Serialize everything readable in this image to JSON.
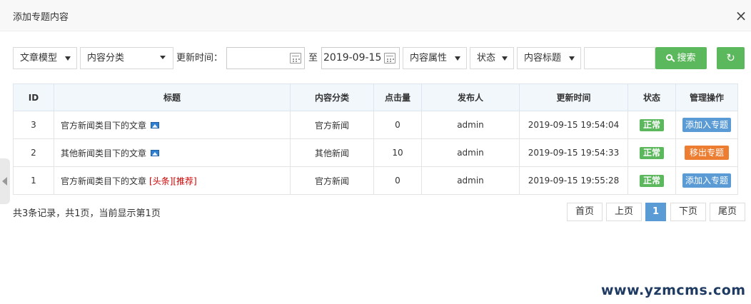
{
  "dialog": {
    "title": "添加专题内容",
    "close_symbol": "×"
  },
  "filters": {
    "model": "文章模型",
    "category": "内容分类",
    "update_time_label": "更新时间：",
    "date_start": "",
    "to_label": "至",
    "date_end": "2019-09-15",
    "attribute": "内容属性",
    "status": "状态",
    "field": "内容标题",
    "keyword": "",
    "search_label": "搜索",
    "refresh_symbol": "↻"
  },
  "table": {
    "headers": [
      "ID",
      "标题",
      "内容分类",
      "点击量",
      "发布人",
      "更新时间",
      "状态",
      "管理操作"
    ],
    "rows": [
      {
        "id": "3",
        "title": "官方新闻类目下的文章",
        "has_image": true,
        "flags": "",
        "category": "官方新闻",
        "clicks": "0",
        "publisher": "admin",
        "updated": "2019-09-15 19:54:04",
        "status": "正常",
        "action": "添加入专题",
        "action_type": "add"
      },
      {
        "id": "2",
        "title": "其他新闻类目下的文章",
        "has_image": true,
        "flags": "",
        "category": "其他新闻",
        "clicks": "10",
        "publisher": "admin",
        "updated": "2019-09-15 19:54:33",
        "status": "正常",
        "action": "移出专题",
        "action_type": "remove"
      },
      {
        "id": "1",
        "title": "官方新闻类目下的文章",
        "has_image": false,
        "flags": "[头条][推荐]",
        "category": "官方新闻",
        "clicks": "0",
        "publisher": "admin",
        "updated": "2019-09-15 19:55:28",
        "status": "正常",
        "action": "添加入专题",
        "action_type": "add"
      }
    ]
  },
  "summary": "共3条记录，共1页，当前显示第1页",
  "pagination": {
    "first": "首页",
    "prev": "上页",
    "current": "1",
    "next": "下页",
    "last": "尾页"
  },
  "watermark": "www.yzmcms.com",
  "colors": {
    "green": "#5cb85c",
    "blue": "#5b9bd5",
    "orange": "#ed7d31",
    "flag_red": "#cc0000"
  }
}
